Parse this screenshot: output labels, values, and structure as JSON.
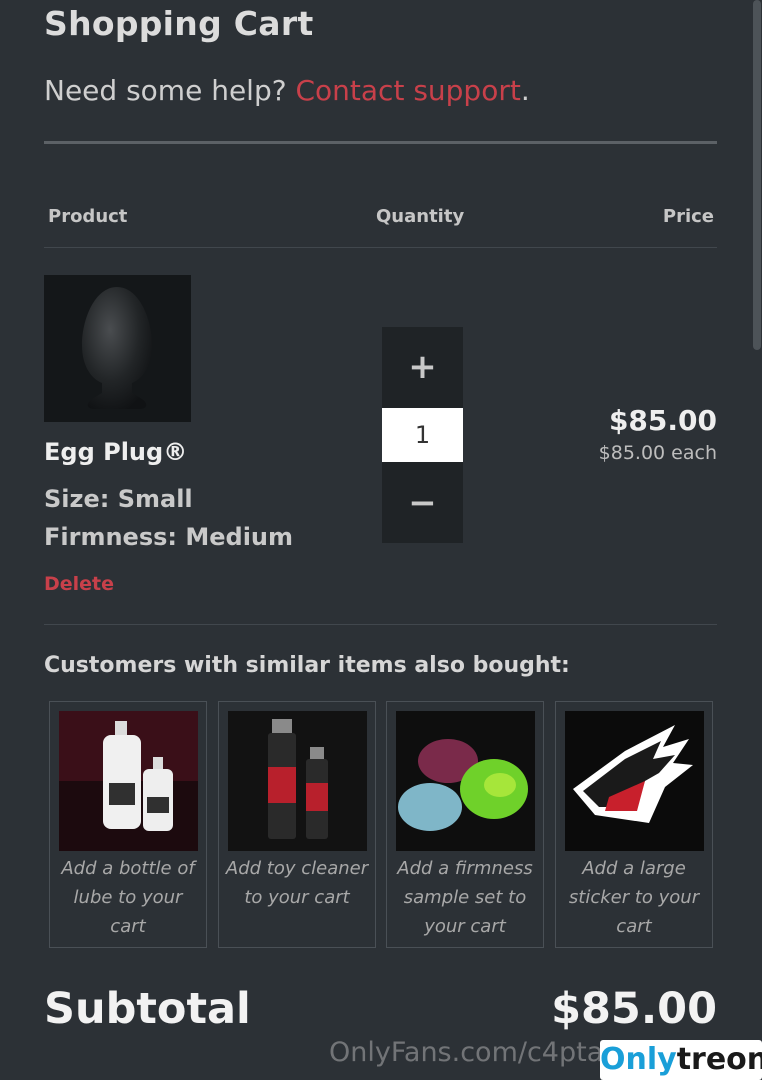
{
  "header": {
    "title": "Shopping Cart",
    "help_prefix": "Need some help? ",
    "help_link": "Contact support",
    "help_suffix": "."
  },
  "table": {
    "col_product": "Product",
    "col_quantity": "Quantity",
    "col_price": "Price"
  },
  "item": {
    "name": "Egg Plug®",
    "size": "Size: Small",
    "firmness": "Firmness: Medium",
    "delete_label": "Delete",
    "quantity": "1",
    "increment": "+",
    "decrement": "−",
    "price": "$85.00",
    "price_each": "$85.00 each"
  },
  "recommendations": {
    "heading": "Customers with similar items also bought:",
    "items": [
      {
        "text": "Add a bottle of lube to your cart",
        "icon": "lube-bottles-image"
      },
      {
        "text": "Add toy cleaner to your cart",
        "icon": "toy-cleaner-image"
      },
      {
        "text": "Add a firmness sample set to your cart",
        "icon": "firmness-samples-image"
      },
      {
        "text": "Add a large sticker to your cart",
        "icon": "dragon-sticker-image"
      }
    ]
  },
  "summary": {
    "subtotal_label": "Subtotal",
    "subtotal_value": "$85.00"
  },
  "overlay": {
    "watermark": "OnlyFans.com/c4pta",
    "badge_part1": "Only",
    "badge_part2": "treon"
  },
  "colors": {
    "background": "#2c3136",
    "accent_red": "#c8404a",
    "badge_blue": "#1a9fd8"
  }
}
